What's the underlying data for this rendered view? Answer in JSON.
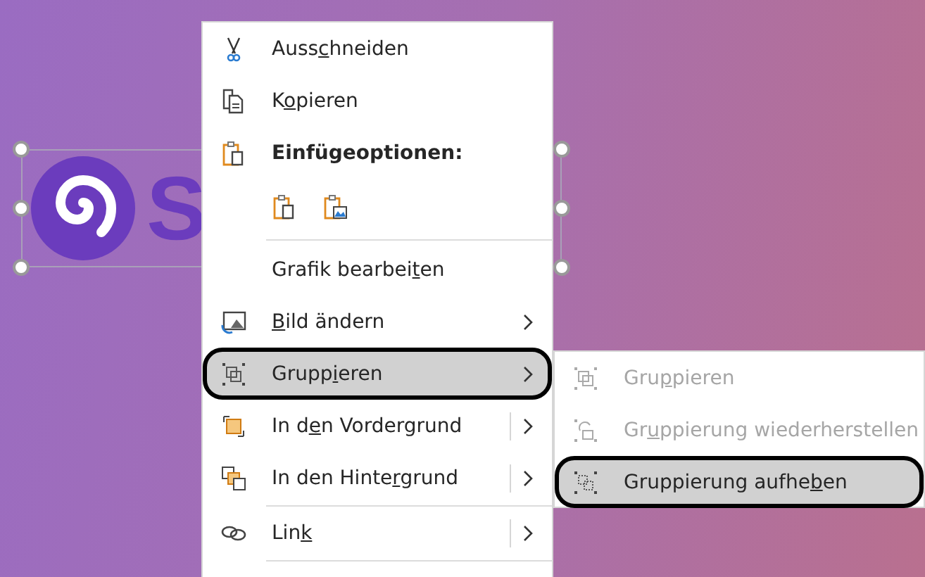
{
  "slide": {
    "logo_text": "S"
  },
  "menu": {
    "items": [
      {
        "kind": "command",
        "label": {
          "before": "Auss",
          "key": "c",
          "after": "hneiden"
        },
        "submenu": false,
        "split": false,
        "selected": false
      },
      {
        "kind": "command",
        "label": {
          "before": "K",
          "key": "o",
          "after": "pieren"
        },
        "submenu": false,
        "split": false,
        "selected": false
      },
      {
        "kind": "heading",
        "text": "Einfügeoptionen:"
      },
      {
        "kind": "paste_options"
      },
      {
        "kind": "separator"
      },
      {
        "kind": "command",
        "label": {
          "before": "Grafik bearbei",
          "key": "t",
          "after": "en"
        },
        "submenu": false,
        "split": false,
        "selected": false
      },
      {
        "kind": "command",
        "label": {
          "key": "B",
          "after": "ild ändern"
        },
        "submenu": true,
        "split": false,
        "selected": false
      },
      {
        "kind": "command",
        "label": {
          "before": "Grupp",
          "key": "i",
          "after": "eren"
        },
        "submenu": true,
        "split": false,
        "selected": true
      },
      {
        "kind": "command",
        "label": {
          "before": "In d",
          "key": "e",
          "after": "n Vordergrund"
        },
        "submenu": true,
        "split": true,
        "selected": false
      },
      {
        "kind": "command",
        "label": {
          "before": "In den Hinte",
          "key": "r",
          "after": "grund"
        },
        "submenu": true,
        "split": true,
        "selected": false
      },
      {
        "kind": "separator"
      },
      {
        "kind": "command",
        "label": {
          "before": "Lin",
          "key": "k"
        },
        "submenu": true,
        "split": true,
        "selected": false
      },
      {
        "kind": "separator"
      }
    ]
  },
  "submenu": {
    "items": [
      {
        "label": {
          "before": "Gru",
          "key": "p",
          "after": "pieren"
        },
        "disabled": true,
        "selected": false
      },
      {
        "label": {
          "before": "Gr",
          "key": "u",
          "after": "ppierung wiederherstellen"
        },
        "disabled": true,
        "selected": false
      },
      {
        "label": {
          "before": "Gruppierung aufhe",
          "key": "b",
          "after": "en"
        },
        "disabled": false,
        "selected": true
      }
    ]
  }
}
